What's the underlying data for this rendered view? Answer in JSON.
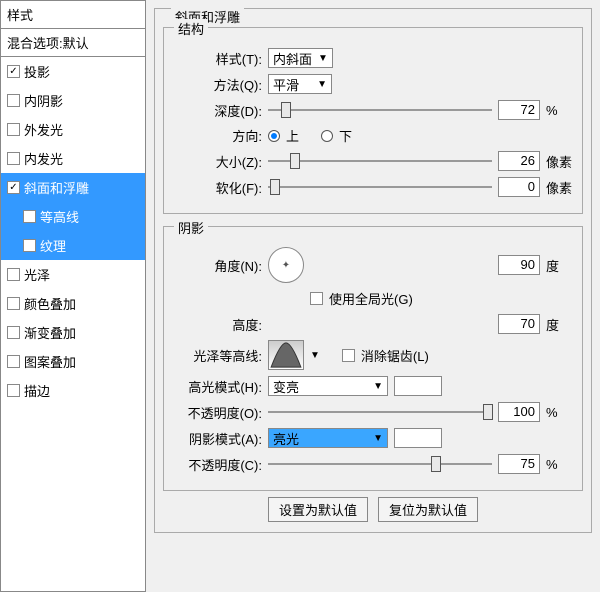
{
  "sidebar": {
    "header": "样式",
    "blend": "混合选项:默认",
    "items": [
      {
        "label": "投影",
        "checked": true
      },
      {
        "label": "内阴影",
        "checked": false
      },
      {
        "label": "外发光",
        "checked": false
      },
      {
        "label": "内发光",
        "checked": false
      },
      {
        "label": "斜面和浮雕",
        "checked": true,
        "selected": true
      },
      {
        "label": "等高线",
        "checked": false,
        "sub": true,
        "selected": true
      },
      {
        "label": "纹理",
        "checked": false,
        "sub": true,
        "selected": true
      },
      {
        "label": "光泽",
        "checked": false
      },
      {
        "label": "颜色叠加",
        "checked": false
      },
      {
        "label": "渐变叠加",
        "checked": false
      },
      {
        "label": "图案叠加",
        "checked": false
      },
      {
        "label": "描边",
        "checked": false
      }
    ]
  },
  "main": {
    "section_title": "斜面和浮雕",
    "structure": {
      "legend": "结构",
      "style_label": "样式(T):",
      "style_value": "内斜面",
      "method_label": "方法(Q):",
      "method_value": "平滑",
      "depth_label": "深度(D):",
      "depth_value": "72",
      "depth_unit": "%",
      "direction_label": "方向:",
      "up": "上",
      "down": "下",
      "size_label": "大小(Z):",
      "size_value": "26",
      "size_unit": "像素",
      "soften_label": "软化(F):",
      "soften_value": "0",
      "soften_unit": "像素"
    },
    "shading": {
      "legend": "阴影",
      "angle_label": "角度(N):",
      "angle_value": "90",
      "angle_unit": "度",
      "use_global": "使用全局光(G)",
      "altitude_label": "高度:",
      "altitude_value": "70",
      "altitude_unit": "度",
      "gloss_label": "光泽等高线:",
      "antialias": "消除锯齿(L)",
      "highlight_mode_label": "高光模式(H):",
      "highlight_mode_value": "变亮",
      "highlight_opacity_label": "不透明度(O):",
      "highlight_opacity_value": "100",
      "opacity_unit": "%",
      "shadow_mode_label": "阴影模式(A):",
      "shadow_mode_value": "亮光",
      "shadow_opacity_label": "不透明度(C):",
      "shadow_opacity_value": "75"
    },
    "buttons": {
      "default": "设置为默认值",
      "reset": "复位为默认值"
    }
  }
}
